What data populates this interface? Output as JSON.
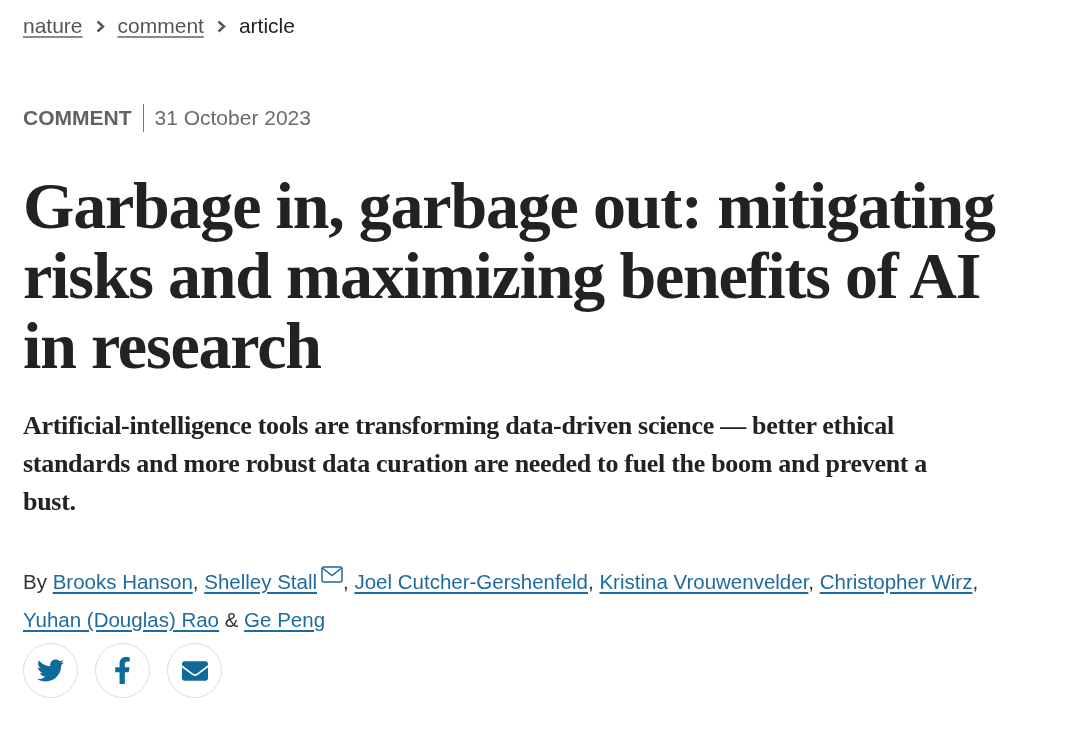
{
  "breadcrumb": [
    {
      "label": "nature",
      "kind": "link"
    },
    {
      "label": "comment",
      "kind": "link"
    },
    {
      "label": "article",
      "kind": "current"
    }
  ],
  "article_meta": {
    "type": "COMMENT",
    "date": "31 October 2023"
  },
  "title": "Garbage in, garbage out: mitigating risks and maximizing benefits of AI in research",
  "standfirst": "Artificial-intelligence tools are transforming data-driven science — better ethical standards and more robust data curation are needed to fuel the boom and prevent a bust.",
  "byline": {
    "prefix": "By",
    "authors": [
      {
        "name": "Brooks Hanson",
        "contact_icon": false,
        "join": {
          "text": ",",
          "kind": "comma"
        }
      },
      {
        "name": "Shelley Stall",
        "contact_icon": true,
        "join": {
          "text": ",",
          "kind": "comma"
        }
      },
      {
        "name": "Joel Cutcher-Gershenfeld",
        "contact_icon": false,
        "join": {
          "text": ",",
          "kind": "comma"
        }
      },
      {
        "name": "Kristina Vrouwenvelder",
        "contact_icon": false,
        "join": {
          "text": ",",
          "kind": "comma"
        }
      },
      {
        "name": "Christopher Wirz",
        "contact_icon": false,
        "join": {
          "text": ",",
          "kind": "comma"
        }
      },
      {
        "name": "Yuhan (Douglas) Rao",
        "contact_icon": false,
        "join": {
          "text": "&",
          "kind": "conjunction"
        }
      },
      {
        "name": "Ge Peng",
        "contact_icon": false
      }
    ]
  },
  "share_buttons": [
    {
      "kind": "twitter"
    },
    {
      "kind": "facebook"
    },
    {
      "kind": "email"
    }
  ]
}
